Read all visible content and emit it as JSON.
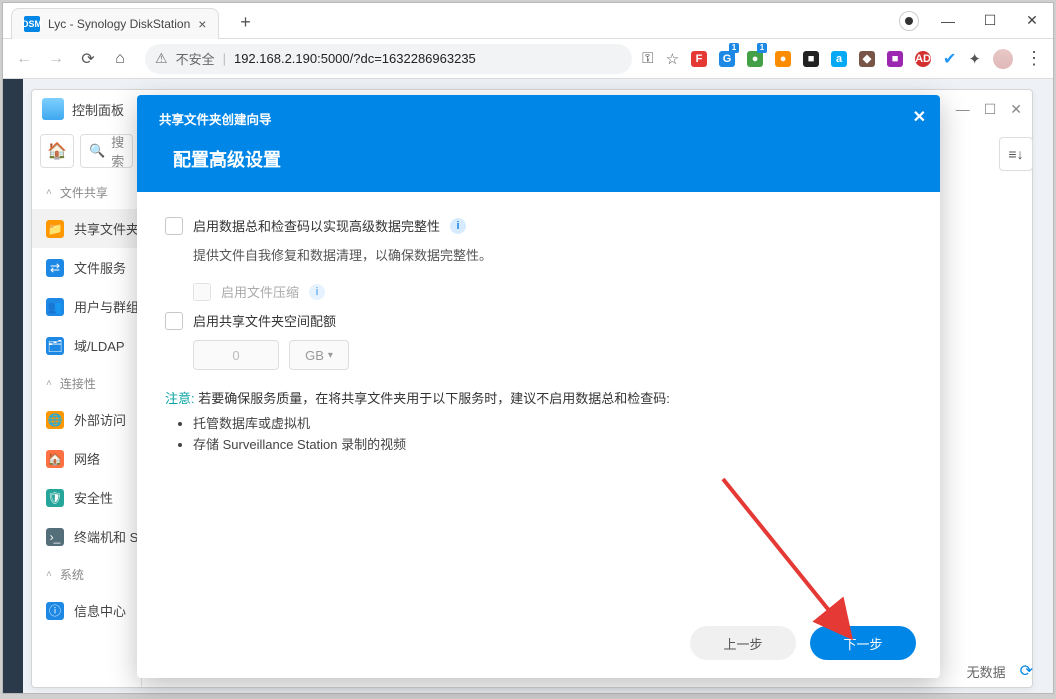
{
  "browser": {
    "tab_title": "Lyc - Synology DiskStation",
    "favicon_text": "DSM",
    "risk_label": "不安全",
    "url": "192.168.2.190:5000/?dc=1632286963235"
  },
  "dsm_window": {
    "title": "控制面板"
  },
  "search": {
    "placeholder": "搜索"
  },
  "sections": {
    "file_share": "文件共享",
    "connect": "连接性",
    "system": "系统"
  },
  "nav": {
    "shared_folder": "共享文件夹",
    "file_service": "文件服务",
    "user_group": "用户与群组",
    "domain_ldap": "域/LDAP",
    "external_access": "外部访问",
    "network": "网络",
    "security": "安全性",
    "terminal_snmp": "终端机和 SNMP",
    "info_center": "信息中心"
  },
  "modal": {
    "wizard_title": "共享文件夹创建向导",
    "title": "配置高级设置",
    "opt_checksum": "启用数据总和检查码以实现高级数据完整性",
    "opt_checksum_desc": "提供文件自我修复和数据清理，以确保数据完整性。",
    "opt_compress": "启用文件压缩",
    "opt_quota": "启用共享文件夹空间配额",
    "quota_value": "0",
    "quota_unit": "GB",
    "note_label": "注意:",
    "note_text": "若要确保服务质量，在将共享文件夹用于以下服务时，建议不启用数据总和检查码:",
    "note_items": [
      "托管数据库或虚拟机",
      "存储 Surveillance Station 录制的视频"
    ],
    "prev": "上一步",
    "next": "下一步"
  },
  "status": {
    "no_data": "无数据"
  }
}
